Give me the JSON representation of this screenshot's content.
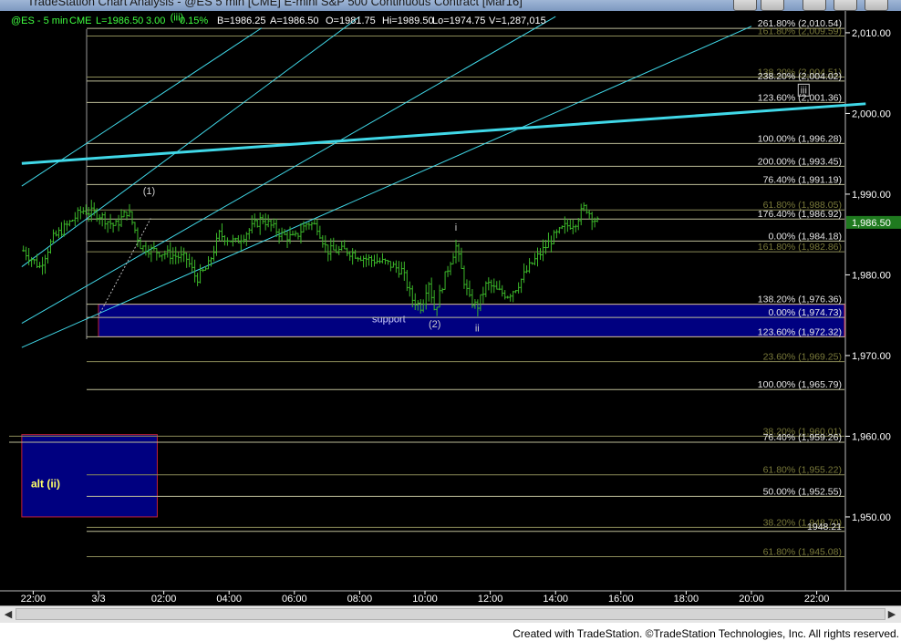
{
  "window": {
    "title": "TradeStation Chart Analysis - @ES 5 min [CME] E-mini S&P 500 Continuous Contract [Mar16]"
  },
  "header": {
    "symbol": "@ES - 5 min",
    "exchange": "CME",
    "last": "L=1986.50",
    "change": "3.00",
    "change_pct": "0.15%",
    "bid": "B=1986.25",
    "ask": "A=1986.50",
    "open": "O=1981.75",
    "high": "Hi=1989.50",
    "low": "Lo=1974.75",
    "volume": "V=1,287,015"
  },
  "footer": {
    "credit": "Created with TradeStation. ©TradeStation Technologies, Inc. All rights reserved."
  },
  "colors": {
    "background": "#000000",
    "bars": "#3cb82a",
    "fib_line": "#bdbd98",
    "fib_dark_label": "#7a7a3a",
    "trend_line": "#40d8e8",
    "support_box": "#000080",
    "box_border": "#c0203a",
    "axis_text": "#ffffff",
    "last_price_box": "#1f7a1f",
    "header_text": "#40ff40"
  },
  "chart_data": {
    "type": "candlestick",
    "title": "@ES - 5 min",
    "y_axis": {
      "side": "right",
      "range": [
        1940.9,
        2011.8
      ],
      "ticks": [
        {
          "value": 2010,
          "label": "2,010.00"
        },
        {
          "value": 2000,
          "label": "2,000.00"
        },
        {
          "value": 1990,
          "label": "1,990.00"
        },
        {
          "value": 1980,
          "label": "1,980.00"
        },
        {
          "value": 1970,
          "label": "1,970.00"
        },
        {
          "value": 1960,
          "label": "1,960.00"
        },
        {
          "value": 1950,
          "label": "1,950.00"
        }
      ]
    },
    "x_axis": {
      "ticks": [
        {
          "label": "22:00",
          "t": -2
        },
        {
          "label": "3/3",
          "t": 0
        },
        {
          "label": "02:00",
          "t": 2
        },
        {
          "label": "04:00",
          "t": 4
        },
        {
          "label": "06:00",
          "t": 6
        },
        {
          "label": "08:00",
          "t": 8
        },
        {
          "label": "10:00",
          "t": 10
        },
        {
          "label": "12:00",
          "t": 12
        },
        {
          "label": "14:00",
          "t": 14
        },
        {
          "label": "16:00",
          "t": 16
        },
        {
          "label": "18:00",
          "t": 18
        },
        {
          "label": "20:00",
          "t": 20
        },
        {
          "label": "22:00",
          "t": 22
        }
      ]
    },
    "last_price": {
      "value": 1986.5,
      "label": "1,986.50"
    },
    "price_path": [
      [
        -2.3,
        1983.0
      ],
      [
        -1.8,
        1981.0
      ],
      [
        -1.4,
        1984.5
      ],
      [
        -1.0,
        1986.0
      ],
      [
        -0.5,
        1988.0
      ],
      [
        0.0,
        1987.5
      ],
      [
        0.5,
        1986.0
      ],
      [
        0.9,
        1988.0
      ],
      [
        1.3,
        1983.5
      ],
      [
        1.7,
        1983.0
      ],
      [
        2.2,
        1982.5
      ],
      [
        2.7,
        1982.0
      ],
      [
        3.0,
        1979.5
      ],
      [
        3.35,
        1981.0
      ],
      [
        3.7,
        1985.0
      ],
      [
        4.2,
        1984.0
      ],
      [
        5.0,
        1987.0
      ],
      [
        5.6,
        1985.0
      ],
      [
        6.0,
        1984.5
      ],
      [
        6.4,
        1986.5
      ],
      [
        6.7,
        1986.0
      ],
      [
        7.0,
        1983.0
      ],
      [
        7.6,
        1983.0
      ],
      [
        8.2,
        1982.0
      ],
      [
        8.8,
        1981.5
      ],
      [
        9.3,
        1980.5
      ],
      [
        9.6,
        1977.0
      ],
      [
        9.9,
        1976.0
      ],
      [
        10.1,
        1979.5
      ],
      [
        10.3,
        1975.5
      ],
      [
        10.55,
        1979.0
      ],
      [
        10.8,
        1982.0
      ],
      [
        10.95,
        1983.5
      ],
      [
        11.15,
        1980.0
      ],
      [
        11.35,
        1977.0
      ],
      [
        11.6,
        1976.0
      ],
      [
        11.9,
        1979.0
      ],
      [
        12.2,
        1978.0
      ],
      [
        12.55,
        1977.5
      ],
      [
        12.8,
        1978.5
      ],
      [
        13.2,
        1981.0
      ],
      [
        13.6,
        1983.0
      ],
      [
        13.9,
        1984.5
      ],
      [
        14.3,
        1986.0
      ],
      [
        14.6,
        1986.5
      ],
      [
        14.9,
        1988.5
      ],
      [
        15.15,
        1987.0
      ],
      [
        15.3,
        1986.5
      ]
    ],
    "fib_levels": [
      {
        "label": "261.80% (2,010.54)",
        "value": 2010.54
      },
      {
        "label": "161.80% (2,009.59)",
        "value": 2009.59,
        "dim": true
      },
      {
        "label": "138.20% (2,004.51)",
        "value": 2004.51,
        "dim": true
      },
      {
        "label": "238.20% (2,004.02)",
        "value": 2004.02
      },
      {
        "label": "123.60% (2,001.36)",
        "value": 2001.36
      },
      {
        "label": "100.00% (1,996.28)",
        "value": 1996.28
      },
      {
        "label": "200.00% (1,993.45)",
        "value": 1993.45
      },
      {
        "label": "76.40% (1,991.19)",
        "value": 1991.19
      },
      {
        "label": "61.80% (1,988.05)",
        "value": 1988.05,
        "dim": true
      },
      {
        "label": "176.40% (1,986.92)",
        "value": 1986.92
      },
      {
        "label": "0.00% (1,984.18)",
        "value": 1984.18
      },
      {
        "label": "161.80% (1,982.86)",
        "value": 1982.86,
        "dim": true
      },
      {
        "label": "138.20% (1,976.36)",
        "value": 1976.36
      },
      {
        "label": "0.00% (1,974.73)",
        "value": 1974.73
      },
      {
        "label": "123.60% (1,972.32)",
        "value": 1972.32
      },
      {
        "label": "23.60% (1,969.25)",
        "value": 1969.25,
        "dim": true
      },
      {
        "label": "100.00% (1,965.79)",
        "value": 1965.79
      },
      {
        "label": "38.20% (1,960.01)",
        "value": 1960.01,
        "dim": true
      },
      {
        "label": "76.40% (1,959.26)",
        "value": 1959.26
      },
      {
        "label": "61.80% (1,955.22)",
        "value": 1955.22,
        "dim": true
      },
      {
        "label": "50.00% (1,952.55)",
        "value": 1952.55
      },
      {
        "label": "38.20% (1,948.70)",
        "value": 1948.7,
        "dim": true
      },
      {
        "label": "1948.21",
        "value": 1948.21
      },
      {
        "label": "61.80% (1,945.08)",
        "value": 1945.08,
        "dim": true
      }
    ],
    "zones": [
      {
        "label": "support",
        "from": 1972.32,
        "to": 1976.36,
        "t_start": 0.0,
        "t_end": 23.5
      },
      {
        "label": "alt (ii)",
        "from": 1950.0,
        "to": 1960.2,
        "t_start": -2.35,
        "t_end": 1.8
      }
    ],
    "wave_labels": [
      {
        "label": "(1)",
        "t": 1.55,
        "value": 1990.0
      },
      {
        "label": "(2)",
        "t": 10.3,
        "value": 1973.5
      },
      {
        "label": "i",
        "t": 10.95,
        "value": 1985.5
      },
      {
        "label": "ii",
        "t": 11.6,
        "value": 1973.0
      },
      {
        "label": "iii",
        "t": 21.6,
        "value": 2002.5,
        "boxed": true
      },
      {
        "label": "(iii)",
        "t": 2.4,
        "value": 2011.5
      }
    ],
    "trend_lines": [
      {
        "points": [
          [
            -2.35,
            1993.8
          ],
          [
            23.5,
            2001.2
          ]
        ],
        "weight": "thick"
      },
      {
        "points": [
          [
            -2.35,
            1991.0
          ],
          [
            5.0,
            2010.6
          ]
        ]
      },
      {
        "points": [
          [
            -2.35,
            1981.0
          ],
          [
            8.0,
            2012.0
          ]
        ]
      },
      {
        "points": [
          [
            -2.35,
            1974.0
          ],
          [
            14.0,
            2012.0
          ]
        ]
      },
      {
        "points": [
          [
            -2.35,
            1971.0
          ],
          [
            20.0,
            2010.8
          ]
        ]
      }
    ]
  }
}
